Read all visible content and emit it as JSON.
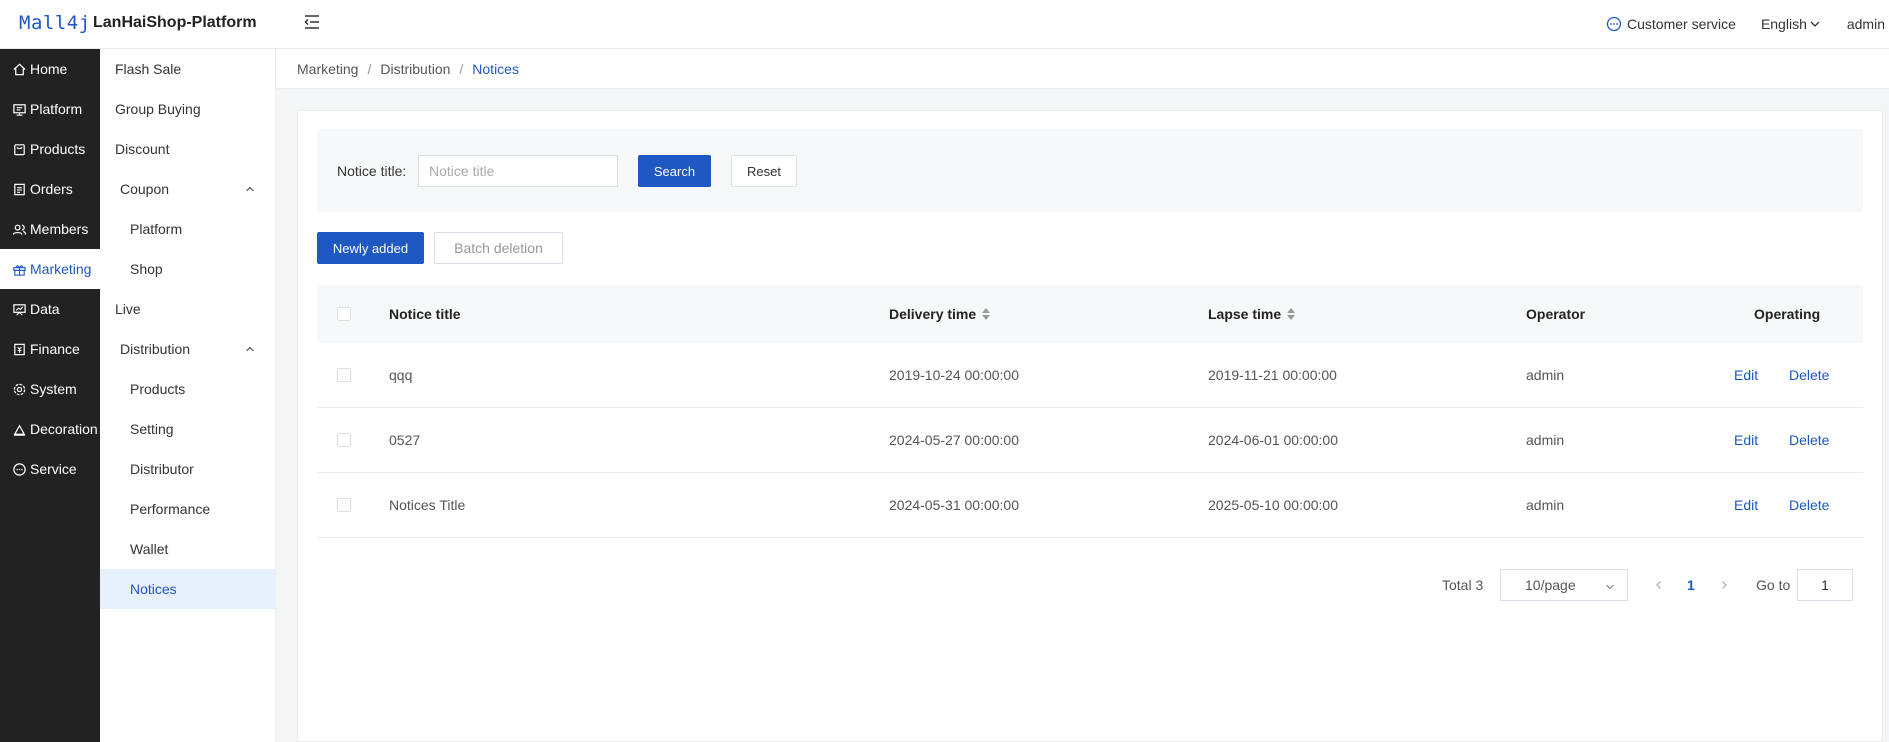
{
  "header": {
    "logo": "Mall4j",
    "platform_name": "LanHaiShop-Platform",
    "customer_service": "Customer service",
    "language": "English",
    "user": "admin"
  },
  "sidebar": {
    "items": [
      {
        "label": "Home",
        "icon": "home-icon"
      },
      {
        "label": "Platform",
        "icon": "monitor-icon"
      },
      {
        "label": "Products",
        "icon": "bag-icon"
      },
      {
        "label": "Orders",
        "icon": "order-icon"
      },
      {
        "label": "Members",
        "icon": "members-icon"
      },
      {
        "label": "Marketing",
        "icon": "gift-icon",
        "active": true
      },
      {
        "label": "Data",
        "icon": "chart-icon"
      },
      {
        "label": "Finance",
        "icon": "finance-icon"
      },
      {
        "label": "System",
        "icon": "gear-icon"
      },
      {
        "label": "Decoration",
        "icon": "decoration-icon"
      },
      {
        "label": "Service",
        "icon": "chat-icon"
      }
    ]
  },
  "submenu": {
    "items": [
      {
        "label": "Flash Sale"
      },
      {
        "label": "Group Buying"
      },
      {
        "label": "Discount"
      },
      {
        "label": "Coupon"
      },
      {
        "label": "Platform"
      },
      {
        "label": "Shop"
      },
      {
        "label": "Live"
      },
      {
        "label": "Distribution"
      },
      {
        "label": "Products"
      },
      {
        "label": "Setting"
      },
      {
        "label": "Distributor"
      },
      {
        "label": "Performance"
      },
      {
        "label": "Wallet"
      },
      {
        "label": "Notices",
        "active": true
      }
    ]
  },
  "breadcrumb": {
    "items": [
      "Marketing",
      "Distribution",
      "Notices"
    ]
  },
  "search": {
    "label": "Notice title:",
    "placeholder": "Notice title",
    "value": "",
    "search_label": "Search",
    "reset_label": "Reset"
  },
  "toolbar": {
    "add_label": "Newly added",
    "batch_delete_label": "Batch deletion"
  },
  "table": {
    "columns": [
      "Notice title",
      "Delivery time",
      "Lapse time",
      "Operator",
      "Operating"
    ],
    "rows": [
      {
        "title": "qqq",
        "delivery": "2019-10-24 00:00:00",
        "lapse": "2019-11-21 00:00:00",
        "operator": "admin",
        "edit": "Edit",
        "delete": "Delete"
      },
      {
        "title": "0527",
        "delivery": "2024-05-27 00:00:00",
        "lapse": "2024-06-01 00:00:00",
        "operator": "admin",
        "edit": "Edit",
        "delete": "Delete"
      },
      {
        "title": "Notices Title",
        "delivery": "2024-05-31 00:00:00",
        "lapse": "2025-05-10 00:00:00",
        "operator": "admin",
        "edit": "Edit",
        "delete": "Delete"
      }
    ]
  },
  "pagination": {
    "total": "Total 3",
    "page_size": "10/page",
    "current_page": "1",
    "goto_label": "Go to",
    "goto_value": "1"
  },
  "colors": {
    "accent": "#1f57c3",
    "sidebar_bg": "#222222",
    "active_submenu_bg": "#e8f0fc"
  }
}
